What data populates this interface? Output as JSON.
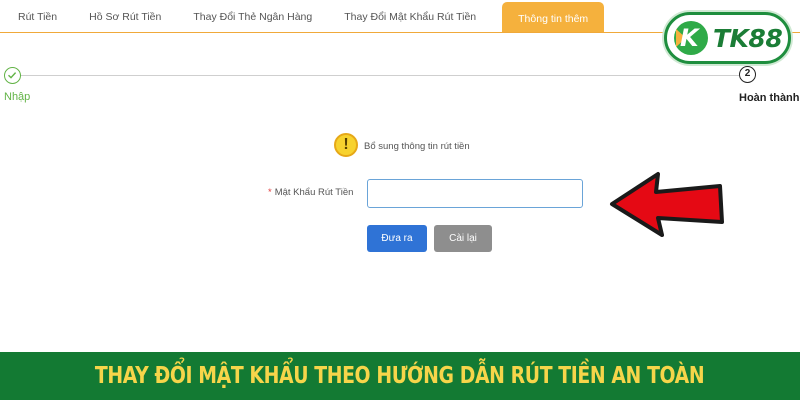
{
  "tabs": [
    {
      "label": "Rút Tiền",
      "active": false
    },
    {
      "label": "Hồ Sơ Rút Tiền",
      "active": false
    },
    {
      "label": "Thay Đổi Thẻ Ngân Hàng",
      "active": false
    },
    {
      "label": "Thay Đổi Mật Khẩu Rút Tiền",
      "active": false
    },
    {
      "label": "Thông tin thêm",
      "active": true
    }
  ],
  "logo": {
    "text": "TK88",
    "mark": "K"
  },
  "stepper": {
    "step1": {
      "label": "Nhập",
      "status": "done",
      "icon": "check-icon"
    },
    "step2": {
      "number": "2",
      "label": "Hoàn thành",
      "status": "pending"
    }
  },
  "notice": {
    "icon": "exclamation-icon",
    "glyph": "!",
    "text": "Bổ sung thông tin rút tiền"
  },
  "form": {
    "required_mark": "*",
    "password_label": "Mật Khẩu Rút Tiền",
    "password_value": "",
    "submit_label": "Đưa ra",
    "reset_label": "Cài lại"
  },
  "banner": {
    "text": "THAY ĐỔI MẬT KHẨU THEO HƯỚNG DẪN RÚT TIỀN AN TOÀN"
  },
  "colors": {
    "tab_active": "#f5b13d",
    "step_done": "#62b346",
    "submit_button": "#2f73d6",
    "reset_button": "#8e8e8e",
    "banner_bg": "#137a33",
    "banner_text": "#f6d54a",
    "arrow": "#e50914"
  }
}
